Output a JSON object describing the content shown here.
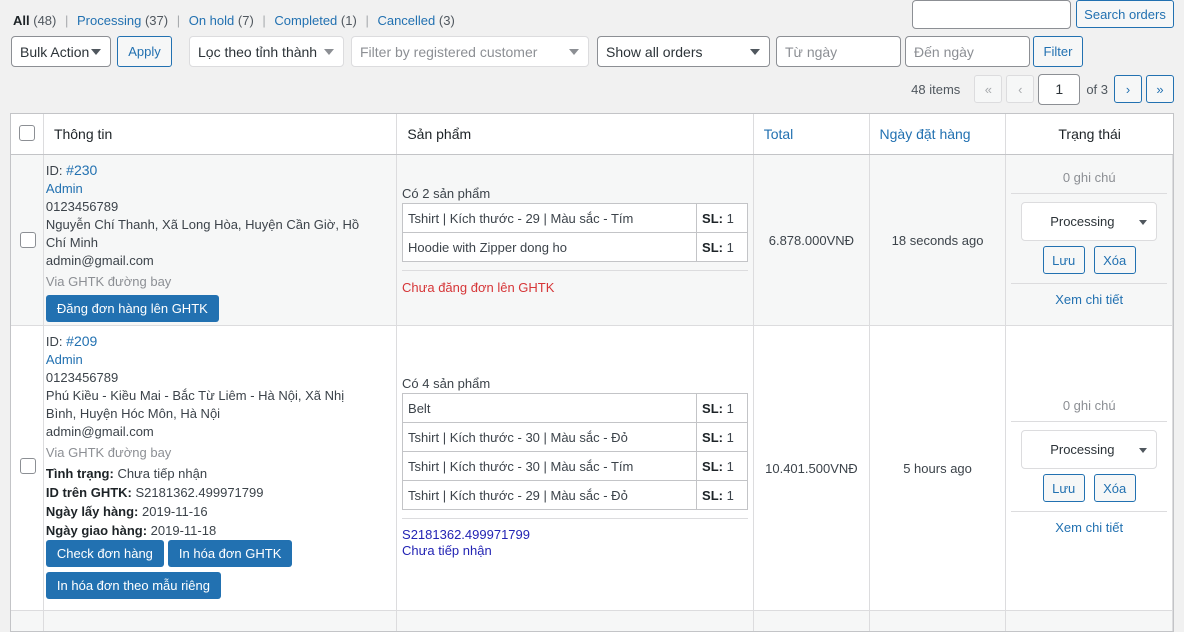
{
  "filters": {
    "status_links": [
      {
        "label": "All",
        "count": "(48)",
        "current": true
      },
      {
        "label": "Processing",
        "count": "(37)"
      },
      {
        "label": "On hold",
        "count": "(7)"
      },
      {
        "label": "Completed",
        "count": "(1)"
      },
      {
        "label": "Cancelled",
        "count": "(3)"
      }
    ],
    "separator": "|",
    "search_value": "",
    "search_button": "Search orders",
    "bulk_action": "Bulk Action",
    "apply": "Apply",
    "province": "Lọc theo tỉnh thành",
    "customer_placeholder": "Filter by registered customer",
    "show_orders": "Show all orders",
    "from_date_placeholder": "Từ ngày",
    "to_date_placeholder": "Đến ngày",
    "filter_button": "Filter"
  },
  "pagination": {
    "items": "48 items",
    "first": "«",
    "prev": "‹",
    "current_page": "1",
    "of": "of 3",
    "next": "›",
    "last": "»"
  },
  "table": {
    "headers": {
      "info": "Thông tin",
      "products": "Sản phẩm",
      "total": "Total",
      "date": "Ngày đặt hàng",
      "status": "Trạng thái"
    }
  },
  "orders": [
    {
      "id_label": "ID:",
      "id": "#230",
      "customer": "Admin",
      "phone": "0123456789",
      "address": "Nguyễn Chí Thanh, Xã Long Hòa, Huyện Cần Giờ, Hồ Chí Minh",
      "email": "admin@gmail.com",
      "shipping": "Via GHTK đường bay",
      "action": "Đăng đơn hàng lên GHTK",
      "product_count": "Có 2 sản phẩm",
      "items": [
        {
          "name": "Tshirt | Kích thước - 29 | Màu sắc - Tím",
          "qty_label": "SL:",
          "qty": "1"
        },
        {
          "name": "Hoodie with Zipper dong ho",
          "qty_label": "SL:",
          "qty": "1"
        }
      ],
      "ghtk_status": "Chưa đăng đơn lên GHTK",
      "total": "6.878.000VNĐ",
      "date": "18 seconds ago",
      "notes": "0 ghi chú",
      "status": "Processing",
      "save": "Lưu",
      "delete": "Xóa",
      "view": "Xem chi tiết"
    },
    {
      "id_label": "ID:",
      "id": "#209",
      "customer": "Admin",
      "phone": "0123456789",
      "address": "Phú Kiều - Kiều Mai - Bắc Từ Liêm - Hà Nội, Xã Nhị Bình, Huyện Hóc Môn, Hà Nội",
      "email": "admin@gmail.com",
      "shipping": "Via GHTK đường bay",
      "details": [
        {
          "label": "Tình trạng:",
          "value": "Chưa tiếp nhận"
        },
        {
          "label": "ID trên GHTK:",
          "value": "S2181362.499971799"
        },
        {
          "label": "Ngày lấy hàng:",
          "value": "2019-11-16"
        },
        {
          "label": "Ngày giao hàng:",
          "value": "2019-11-18"
        }
      ],
      "actions": [
        "Check đơn hàng",
        "In hóa đơn GHTK",
        "In hóa đơn theo mẫu riêng"
      ],
      "product_count": "Có 4 sản phẩm",
      "items": [
        {
          "name": "Belt",
          "qty_label": "SL:",
          "qty": "1"
        },
        {
          "name": "Tshirt | Kích thước - 30 | Màu sắc - Đỏ",
          "qty_label": "SL:",
          "qty": "1"
        },
        {
          "name": "Tshirt | Kích thước - 30 | Màu sắc - Tím",
          "qty_label": "SL:",
          "qty": "1"
        },
        {
          "name": "Tshirt | Kích thước - 29 | Màu sắc - Đỏ",
          "qty_label": "SL:",
          "qty": "1"
        }
      ],
      "ghtk_code": "S2181362.499971799",
      "ghtk_status": "Chưa tiếp nhận",
      "total": "10.401.500VNĐ",
      "date": "5 hours ago",
      "notes": "0 ghi chú",
      "status": "Processing",
      "save": "Lưu",
      "delete": "Xóa",
      "view": "Xem chi tiết"
    }
  ],
  "colors": {
    "link": "#2271b1",
    "primary_button": "#2271b1",
    "error_text": "#d63638",
    "tracking_text": "#2324b4"
  }
}
